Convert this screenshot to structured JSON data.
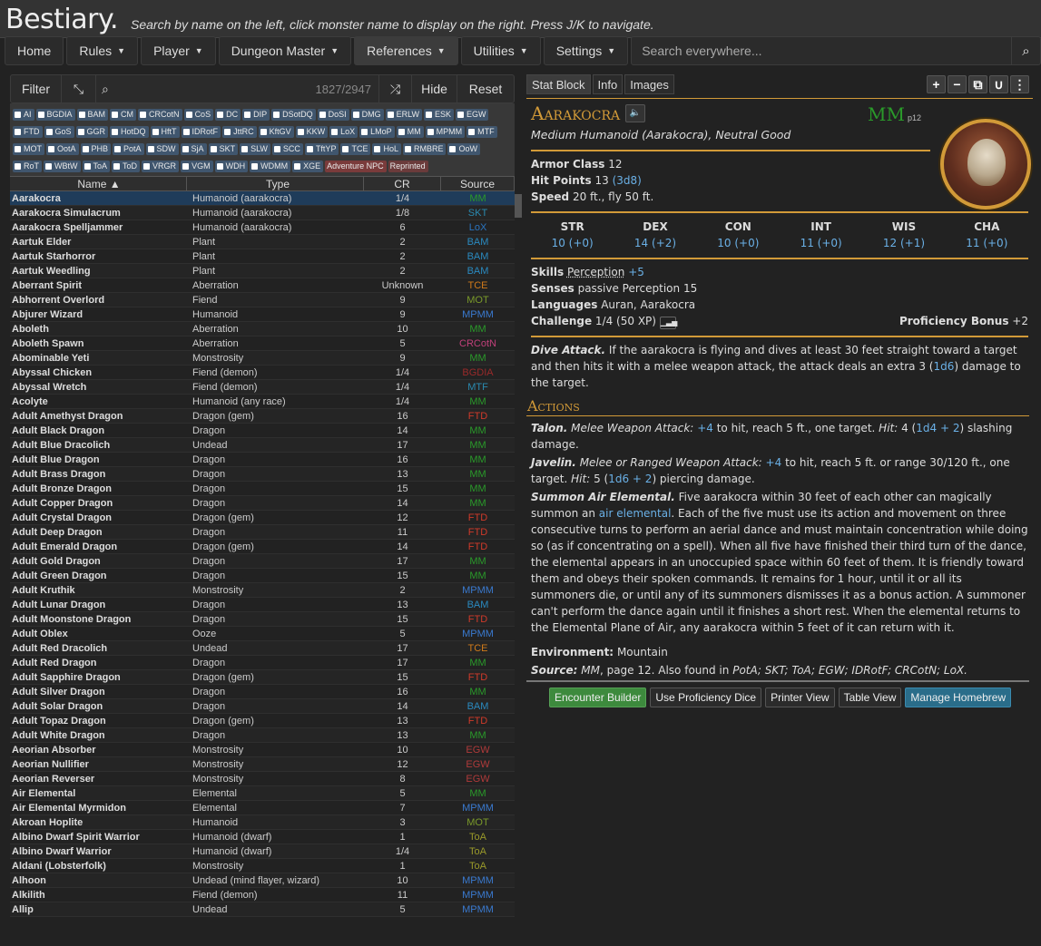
{
  "header": {
    "title": "Bestiary.",
    "subtitle": "Search by name on the left, click monster name to display on the right. Press J/K to navigate."
  },
  "nav": [
    {
      "label": "Home"
    },
    {
      "label": "Rules"
    },
    {
      "label": "Player"
    },
    {
      "label": "Dungeon Master"
    },
    {
      "label": "References"
    },
    {
      "label": "Utilities"
    },
    {
      "label": "Settings"
    }
  ],
  "search": {
    "placeholder": "Search everywhere..."
  },
  "filter": {
    "label": "Filter",
    "count": "1827/2947",
    "hide": "Hide",
    "reset": "Reset"
  },
  "pills": [
    "AI",
    "BGDIA",
    "BAM",
    "CM",
    "CRCotN",
    "CoS",
    "DC",
    "DIP",
    "DSotDQ",
    "DoSI",
    "DMG",
    "ERLW",
    "ESK",
    "EGW",
    "FTD",
    "GoS",
    "GGR",
    "HotDQ",
    "HftT",
    "IDRotF",
    "JttRC",
    "KftGV",
    "KKW",
    "LoX",
    "LMoP",
    "MM",
    "MPMM",
    "MTF",
    "MOT",
    "OotA",
    "PHB",
    "PotA",
    "SDW",
    "SjA",
    "SKT",
    "SLW",
    "SCC",
    "TftYP",
    "TCE",
    "HoL",
    "RMBRE",
    "OoW",
    "RoT",
    "WBtW",
    "ToA",
    "ToD",
    "VRGR",
    "VGM",
    "WDH",
    "WDMM",
    "XGE"
  ],
  "pill_badges": [
    "Adventure NPC",
    "Reprinted"
  ],
  "table": {
    "headers": {
      "name": "Name ▲",
      "type": "Type",
      "cr": "CR",
      "source": "Source"
    },
    "rows": [
      [
        "Aarakocra",
        "Humanoid (aarakocra)",
        "1/4",
        "MM",
        "#2a9a2a"
      ],
      [
        "Aarakocra Simulacrum",
        "Humanoid (aarakocra)",
        "1/8",
        "SKT",
        "#2a8ab0"
      ],
      [
        "Aarakocra Spelljammer",
        "Humanoid (aarakocra)",
        "6",
        "LoX",
        "#2a74c0"
      ],
      [
        "Aartuk Elder",
        "Plant",
        "2",
        "BAM",
        "#2a8ac0"
      ],
      [
        "Aartuk Starhorror",
        "Plant",
        "2",
        "BAM",
        "#2a8ac0"
      ],
      [
        "Aartuk Weedling",
        "Plant",
        "2",
        "BAM",
        "#2a8ac0"
      ],
      [
        "Aberrant Spirit",
        "Aberration",
        "Unknown",
        "TCE",
        "#d07a1a"
      ],
      [
        "Abhorrent Overlord",
        "Fiend",
        "9",
        "MOT",
        "#7a9a2a"
      ],
      [
        "Abjurer Wizard",
        "Humanoid",
        "9",
        "MPMM",
        "#3a7ad0"
      ],
      [
        "Aboleth",
        "Aberration",
        "10",
        "MM",
        "#2a9a2a"
      ],
      [
        "Aboleth Spawn",
        "Aberration",
        "5",
        "CRCotN",
        "#c0407a"
      ],
      [
        "Abominable Yeti",
        "Monstrosity",
        "9",
        "MM",
        "#2a9a2a"
      ],
      [
        "Abyssal Chicken",
        "Fiend (demon)",
        "1/4",
        "BGDIA",
        "#9a2a2a"
      ],
      [
        "Abyssal Wretch",
        "Fiend (demon)",
        "1/4",
        "MTF",
        "#2a8ab0"
      ],
      [
        "Acolyte",
        "Humanoid (any race)",
        "1/4",
        "MM",
        "#2a9a2a"
      ],
      [
        "Adult Amethyst Dragon",
        "Dragon (gem)",
        "16",
        "FTD",
        "#d03a2a"
      ],
      [
        "Adult Black Dragon",
        "Dragon",
        "14",
        "MM",
        "#2a9a2a"
      ],
      [
        "Adult Blue Dracolich",
        "Undead",
        "17",
        "MM",
        "#2a9a2a"
      ],
      [
        "Adult Blue Dragon",
        "Dragon",
        "16",
        "MM",
        "#2a9a2a"
      ],
      [
        "Adult Brass Dragon",
        "Dragon",
        "13",
        "MM",
        "#2a9a2a"
      ],
      [
        "Adult Bronze Dragon",
        "Dragon",
        "15",
        "MM",
        "#2a9a2a"
      ],
      [
        "Adult Copper Dragon",
        "Dragon",
        "14",
        "MM",
        "#2a9a2a"
      ],
      [
        "Adult Crystal Dragon",
        "Dragon (gem)",
        "12",
        "FTD",
        "#d03a2a"
      ],
      [
        "Adult Deep Dragon",
        "Dragon",
        "11",
        "FTD",
        "#d03a2a"
      ],
      [
        "Adult Emerald Dragon",
        "Dragon (gem)",
        "14",
        "FTD",
        "#d03a2a"
      ],
      [
        "Adult Gold Dragon",
        "Dragon",
        "17",
        "MM",
        "#2a9a2a"
      ],
      [
        "Adult Green Dragon",
        "Dragon",
        "15",
        "MM",
        "#2a9a2a"
      ],
      [
        "Adult Kruthik",
        "Monstrosity",
        "2",
        "MPMM",
        "#3a7ad0"
      ],
      [
        "Adult Lunar Dragon",
        "Dragon",
        "13",
        "BAM",
        "#2a8ac0"
      ],
      [
        "Adult Moonstone Dragon",
        "Dragon",
        "15",
        "FTD",
        "#d03a2a"
      ],
      [
        "Adult Oblex",
        "Ooze",
        "5",
        "MPMM",
        "#3a7ad0"
      ],
      [
        "Adult Red Dracolich",
        "Undead",
        "17",
        "TCE",
        "#d07a1a"
      ],
      [
        "Adult Red Dragon",
        "Dragon",
        "17",
        "MM",
        "#2a9a2a"
      ],
      [
        "Adult Sapphire Dragon",
        "Dragon (gem)",
        "15",
        "FTD",
        "#d03a2a"
      ],
      [
        "Adult Silver Dragon",
        "Dragon",
        "16",
        "MM",
        "#2a9a2a"
      ],
      [
        "Adult Solar Dragon",
        "Dragon",
        "14",
        "BAM",
        "#2a8ac0"
      ],
      [
        "Adult Topaz Dragon",
        "Dragon (gem)",
        "13",
        "FTD",
        "#d03a2a"
      ],
      [
        "Adult White Dragon",
        "Dragon",
        "13",
        "MM",
        "#2a9a2a"
      ],
      [
        "Aeorian Absorber",
        "Monstrosity",
        "10",
        "EGW",
        "#b03a3a"
      ],
      [
        "Aeorian Nullifier",
        "Monstrosity",
        "12",
        "EGW",
        "#b03a3a"
      ],
      [
        "Aeorian Reverser",
        "Monstrosity",
        "8",
        "EGW",
        "#b03a3a"
      ],
      [
        "Air Elemental",
        "Elemental",
        "5",
        "MM",
        "#2a9a2a"
      ],
      [
        "Air Elemental Myrmidon",
        "Elemental",
        "7",
        "MPMM",
        "#3a7ad0"
      ],
      [
        "Akroan Hoplite",
        "Humanoid",
        "3",
        "MOT",
        "#7a9a2a"
      ],
      [
        "Albino Dwarf Spirit Warrior",
        "Humanoid (dwarf)",
        "1",
        "ToA",
        "#9a9a2a"
      ],
      [
        "Albino Dwarf Warrior",
        "Humanoid (dwarf)",
        "1/4",
        "ToA",
        "#9a9a2a"
      ],
      [
        "Aldani (Lobsterfolk)",
        "Monstrosity",
        "1",
        "ToA",
        "#9a9a2a"
      ],
      [
        "Alhoon",
        "Undead (mind flayer, wizard)",
        "10",
        "MPMM",
        "#3a7ad0"
      ],
      [
        "Alkilith",
        "Fiend (demon)",
        "11",
        "MPMM",
        "#3a7ad0"
      ],
      [
        "Allip",
        "Undead",
        "5",
        "MPMM",
        "#3a7ad0"
      ]
    ]
  },
  "statblock": {
    "tabs": [
      "Stat Block",
      "Info",
      "Images"
    ],
    "name": "Aarakocra",
    "source": "MM",
    "page": "p12",
    "type_line": "Medium Humanoid (Aarakocra), Neutral Good",
    "ac_label": "Armor Class",
    "ac": "12",
    "hp_label": "Hit Points",
    "hp": "13",
    "hp_dice": "(3d8)",
    "speed_label": "Speed",
    "speed": "20 ft., fly 50 ft.",
    "abilities": [
      {
        "n": "STR",
        "v": "10 (+0)"
      },
      {
        "n": "DEX",
        "v": "14 (+2)"
      },
      {
        "n": "CON",
        "v": "10 (+0)"
      },
      {
        "n": "INT",
        "v": "11 (+0)"
      },
      {
        "n": "WIS",
        "v": "12 (+1)"
      },
      {
        "n": "CHA",
        "v": "11 (+0)"
      }
    ],
    "skills_label": "Skills",
    "skills_name": "Perception",
    "skills_bonus": "+5",
    "senses_label": "Senses",
    "senses": "passive Perception 15",
    "lang_label": "Languages",
    "languages": "Auran, Aarakocra",
    "chal_label": "Challenge",
    "challenge": "1/4 (50 XP)",
    "prof_label": "Proficiency Bonus",
    "prof": "+2",
    "trait_name": "Dive Attack.",
    "trait_a": "If the aarakocra is flying and dives at least 30 feet straight toward a target and then hits it with a melee weapon attack, the attack deals an extra 3 (",
    "trait_dice": "1d6",
    "trait_b": ") damage to the target.",
    "actions_title": "Actions",
    "talon_name": "Talon.",
    "talon_type": "Melee Weapon Attack:",
    "talon_hit": "+4",
    "talon_a": "to hit, reach 5 ft., one target.",
    "hit_lbl": "Hit:",
    "talon_b": "4 (",
    "talon_dice": "1d4 + 2",
    "talon_c": ") slashing damage.",
    "jav_name": "Javelin.",
    "jav_type": "Melee or Ranged Weapon Attack:",
    "jav_hit": "+4",
    "jav_a": "to hit, reach 5 ft. or range 30/120 ft., one target.",
    "jav_b": "5 (",
    "jav_dice": "1d6 + 2",
    "jav_c": ") piercing damage.",
    "sum_name": "Summon Air Elemental.",
    "sum_a": "Five aarakocra within 30 feet of each other can magically summon an",
    "sum_link": "air elemental",
    "sum_b": ". Each of the five must use its action and movement on three consecutive turns to perform an aerial dance and must maintain concentration while doing so (as if concentrating on a spell). When all five have finished their third turn of the dance, the elemental appears in an unoccupied space within 60 feet of them. It is friendly toward them and obeys their spoken commands. It remains for 1 hour, until it or all its summoners die, or until any of its summoners dismisses it as a bonus action. A summoner can't perform the dance again until it finishes a short rest. When the elemental returns to the Elemental Plane of Air, any aarakocra within 5 feet of it can return with it.",
    "env_label": "Environment:",
    "environment": "Mountain",
    "src_label": "Source:",
    "src_a": "MM",
    "src_b": ", page 12. Also found in",
    "src_c": "PotA; SKT; ToA; EGW; IDRotF; CRCotN; LoX."
  },
  "buttons": [
    "Encounter Builder",
    "Use Proficiency Dice",
    "Printer View",
    "Table View",
    "Manage Homebrew"
  ]
}
